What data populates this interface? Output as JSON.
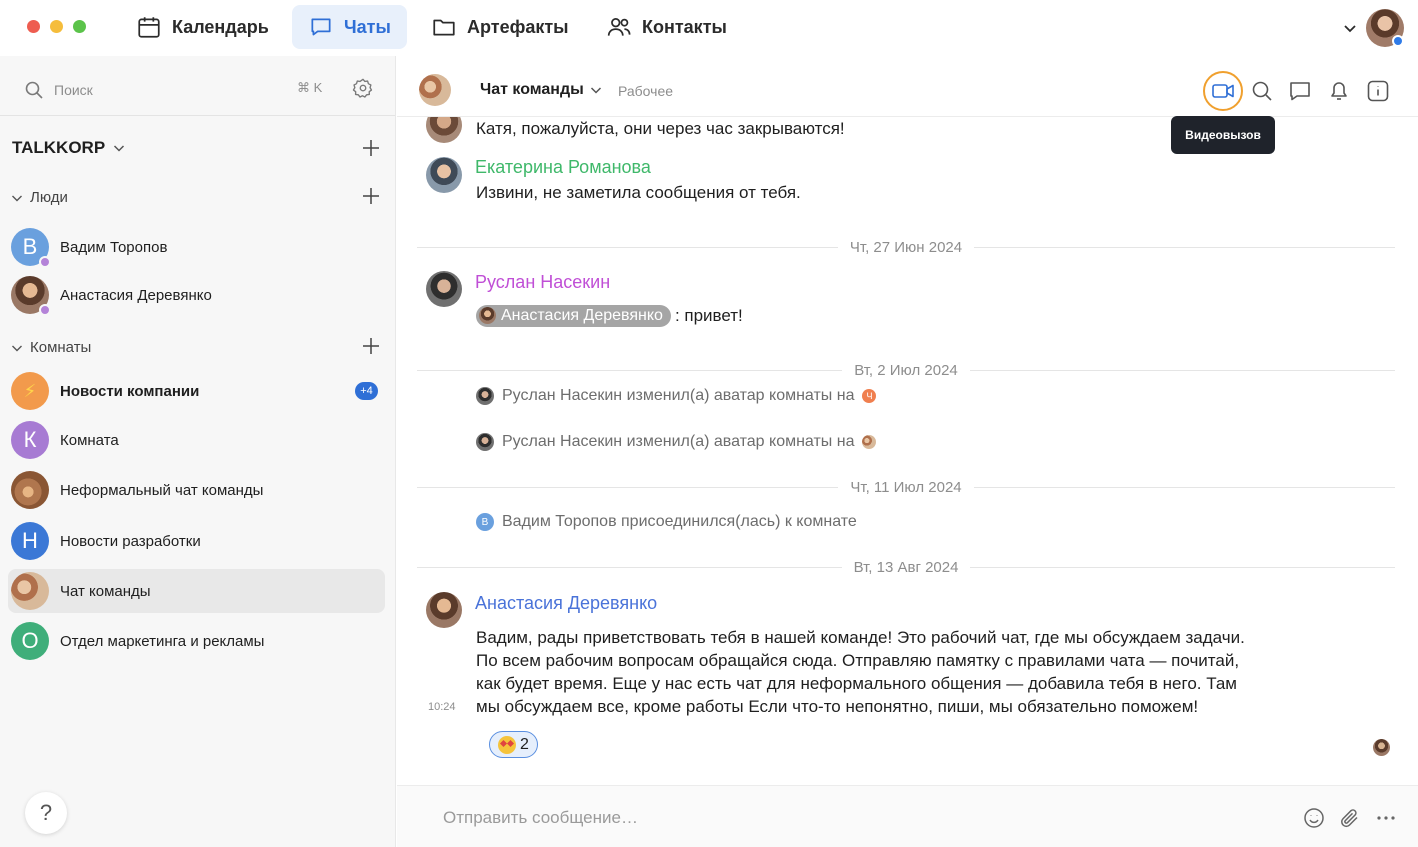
{
  "nav": {
    "tabs": [
      {
        "label": "Календарь",
        "icon": "calendar-icon"
      },
      {
        "label": "Чаты",
        "icon": "chat-icon",
        "active": true
      },
      {
        "label": "Артефакты",
        "icon": "folder-icon"
      },
      {
        "label": "Контакты",
        "icon": "contacts-icon"
      }
    ]
  },
  "sidebar": {
    "search_placeholder": "Поиск",
    "search_shortcut": "⌘ K",
    "workspace": "TALKKORP",
    "sections": {
      "people": "Люди",
      "rooms": "Комнаты"
    },
    "people": [
      {
        "name": "Вадим Торопов",
        "initial": "В",
        "color": "#6aa0de"
      },
      {
        "name": "Анастасия Деревянко",
        "initial": "",
        "color": "#a07b68"
      }
    ],
    "rooms": [
      {
        "name": "Новости компании",
        "initial": "⚡",
        "color": "#f29a4c",
        "bold": true,
        "badge": "+4"
      },
      {
        "name": "Комната",
        "initial": "К",
        "color": "#a77bd3"
      },
      {
        "name": "Неформальный чат команды",
        "initial": "",
        "color": "#b0764e"
      },
      {
        "name": "Новости разработки",
        "initial": "Н",
        "color": "#3b78d6"
      },
      {
        "name": "Чат команды",
        "initial": "",
        "color": "#c99a76",
        "selected": true
      },
      {
        "name": "Отдел маркетинга и рекламы",
        "initial": "О",
        "color": "#3fae7a"
      }
    ],
    "help": "?"
  },
  "chat": {
    "title": "Чат команды",
    "subtitle": "Рабочее",
    "tooltip": "Видеовызов"
  },
  "messages": {
    "partial_text": "Катя, пожалуйста, они через час закрываются!",
    "m1": {
      "author": "Екатерина Романова",
      "author_color": "#3fb86a",
      "text": "Извини, не заметила сообщения от тебя."
    },
    "date1": "Чт, 27 Июн 2024",
    "m2": {
      "author": "Руслан Насекин",
      "author_color": "#c04fd6",
      "mention": "Анастасия Деревянко",
      "text": ": привет!"
    },
    "date2": "Вт, 2 Июл 2024",
    "sys1": "Руслан Насекин изменил(а) аватар комнаты на",
    "sys1_badge": "Ч",
    "sys2": "Руслан Насекин изменил(а) аватар комнаты на",
    "date3": "Чт, 11 Июл 2024",
    "sys3_initial": "В",
    "sys3": "Вадим Торопов присоединился(лась) к комнате",
    "date4": "Вт, 13 Авг 2024",
    "m3": {
      "author": "Анастасия Деревянко",
      "author_color": "#4a73d9",
      "lines": [
        "Вадим, рады приветствовать тебя в нашей команде! Это рабочий чат, где мы обсуждаем задачи.",
        "По всем рабочим вопросам обращайся сюда. Отправляю памятку с правилами чата — почитай,",
        "как будет время. Еще у нас есть чат для неформального общения — добавила тебя в него. Там",
        "мы обсуждаем все, кроме работы  Если что-то непонятно, пиши, мы обязательно поможем!"
      ],
      "time": "10:24",
      "reaction_count": "2"
    }
  },
  "composer": {
    "placeholder": "Отправить сообщение…"
  }
}
